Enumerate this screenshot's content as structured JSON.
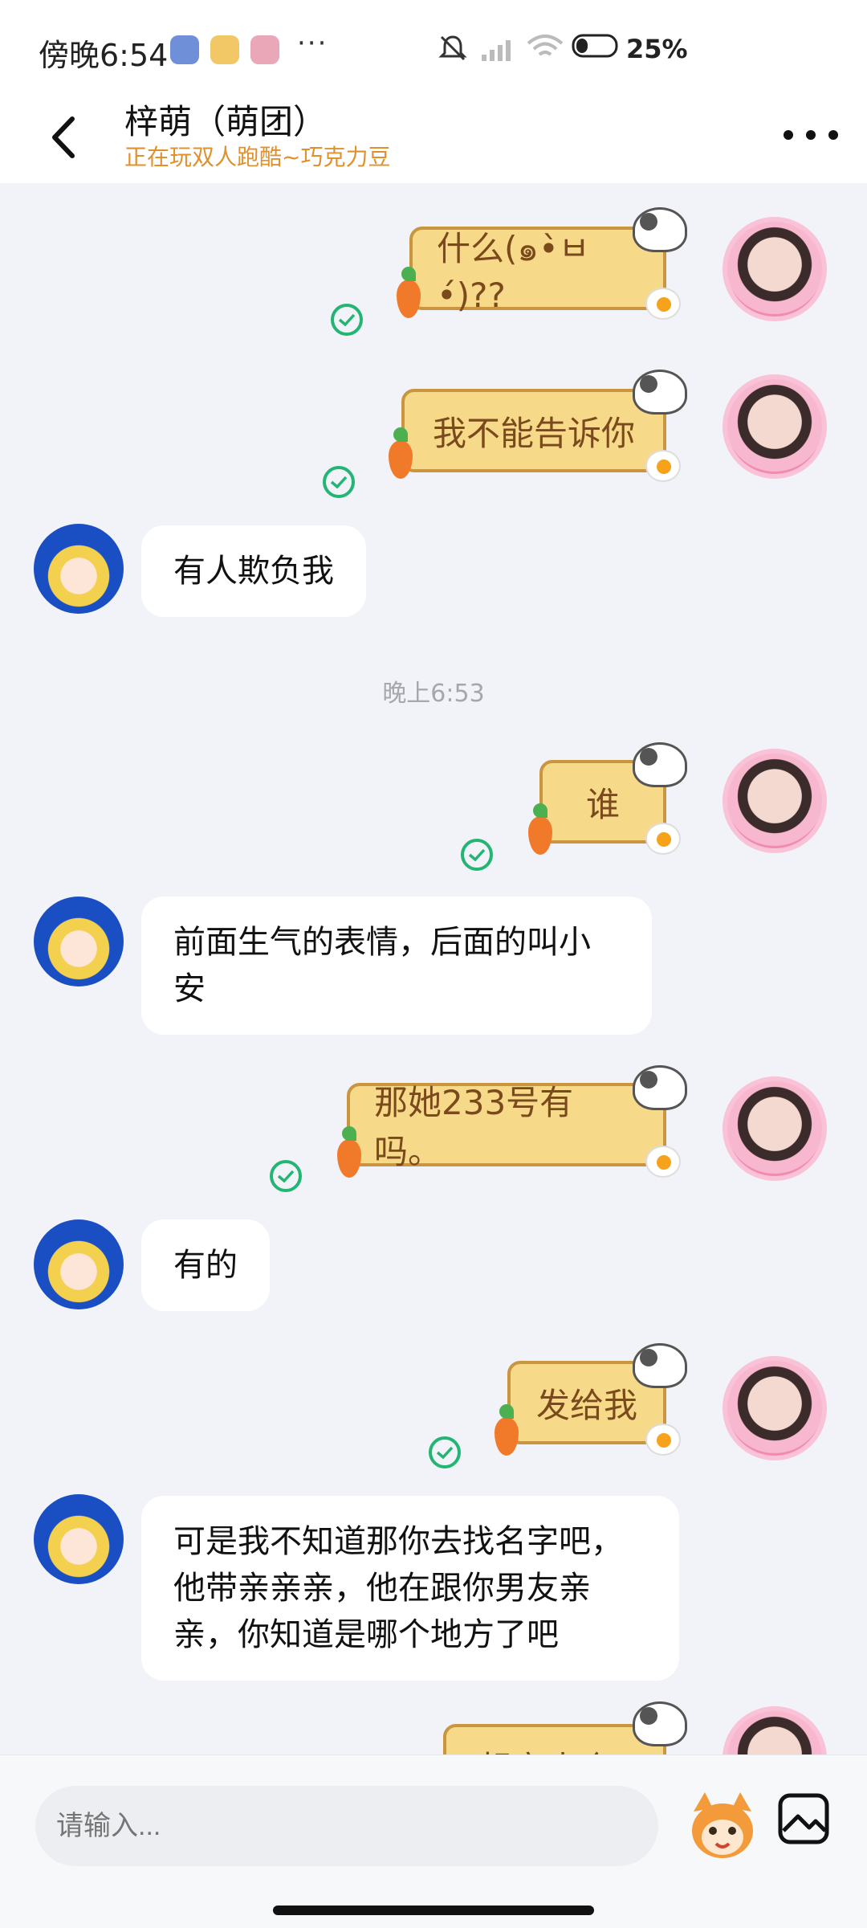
{
  "status_bar": {
    "time": "傍晚6:54",
    "more": "···",
    "battery": "25%"
  },
  "header": {
    "title": "梓萌（萌团）",
    "subtitle": "正在玩双人跑酷~巧克力豆"
  },
  "messages": [
    {
      "side": "me",
      "type": "sticker",
      "text": "什么(๑•̀ㅂ•́)??"
    },
    {
      "side": "me",
      "type": "sticker",
      "text": "我不能告诉你"
    },
    {
      "side": "other",
      "type": "text",
      "text": "有人欺负我"
    },
    {
      "side": "system",
      "type": "time",
      "text": "晚上6:53"
    },
    {
      "side": "me",
      "type": "sticker",
      "text": "谁"
    },
    {
      "side": "other",
      "type": "text",
      "text": "前面生气的表情，后面的叫小安"
    },
    {
      "side": "me",
      "type": "sticker",
      "text": "那她233号有吗。"
    },
    {
      "side": "other",
      "type": "text",
      "text": "有的"
    },
    {
      "side": "me",
      "type": "sticker",
      "text": "发给我"
    },
    {
      "side": "other",
      "type": "text",
      "text": "可是我不知道那你去找名字吧，他带亲亲亲，他在跟你男友亲亲，你知道是哪个地方了吧"
    },
    {
      "side": "me",
      "type": "sticker",
      "text": "想亲小介?"
    }
  ],
  "input": {
    "placeholder": "请输入..."
  },
  "colors": {
    "accent_orange": "#e0912e",
    "sticker_fill": "#f7d98a",
    "sticker_border": "#c9953f",
    "check_green": "#22b573",
    "chat_bg": "#f2f3f8"
  },
  "icons": [
    "back-arrow-icon",
    "more-icon",
    "check-icon",
    "emoji-icon",
    "image-icon",
    "mute-icon",
    "wifi-icon",
    "battery-icon"
  ]
}
